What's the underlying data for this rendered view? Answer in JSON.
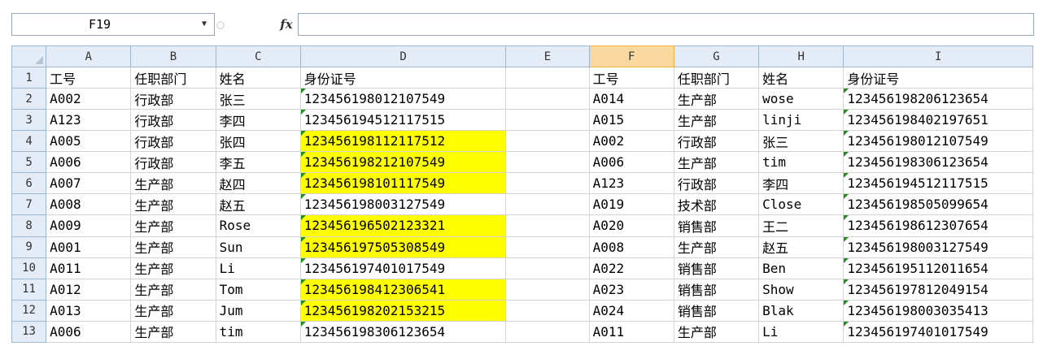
{
  "formula_bar": {
    "name_box": "F19",
    "fx_label": "fx",
    "formula": ""
  },
  "columns": [
    "A",
    "B",
    "C",
    "D",
    "E",
    "F",
    "G",
    "H",
    "I"
  ],
  "selected_column": "F",
  "highlight_color": "#ffff00",
  "rows": [
    {
      "num": "1",
      "cells": [
        "工号",
        "任职部门",
        "姓名",
        "身份证号",
        "",
        "工号",
        "任职部门",
        "姓名",
        "身份证号"
      ],
      "hl_d": false
    },
    {
      "num": "2",
      "cells": [
        "A002",
        "行政部",
        "张三",
        "123456198012107549",
        "",
        "A014",
        "生产部",
        "wose",
        "123456198206123654"
      ],
      "hl_d": false
    },
    {
      "num": "3",
      "cells": [
        "A123",
        "行政部",
        "李四",
        "123456194512117515",
        "",
        "A015",
        "生产部",
        "linji",
        "123456198402197651"
      ],
      "hl_d": false
    },
    {
      "num": "4",
      "cells": [
        "A005",
        "行政部",
        "张四",
        "123456198112117512",
        "",
        "A002",
        "行政部",
        "张三",
        "123456198012107549"
      ],
      "hl_d": true
    },
    {
      "num": "5",
      "cells": [
        "A006",
        "行政部",
        "李五",
        "123456198212107549",
        "",
        "A006",
        "生产部",
        "tim",
        "123456198306123654"
      ],
      "hl_d": true
    },
    {
      "num": "6",
      "cells": [
        "A007",
        "生产部",
        "赵四",
        "123456198101117549",
        "",
        "A123",
        "行政部",
        "李四",
        "123456194512117515"
      ],
      "hl_d": true
    },
    {
      "num": "7",
      "cells": [
        "A008",
        "生产部",
        "赵五",
        "123456198003127549",
        "",
        "A019",
        "技术部",
        "Close",
        "123456198505099654"
      ],
      "hl_d": false
    },
    {
      "num": "8",
      "cells": [
        "A009",
        "生产部",
        "Rose",
        "123456196502123321",
        "",
        "A020",
        "销售部",
        "王二",
        "123456198612307654"
      ],
      "hl_d": true
    },
    {
      "num": "9",
      "cells": [
        "A001",
        "生产部",
        "Sun",
        "123456197505308549",
        "",
        "A008",
        "生产部",
        "赵五",
        "123456198003127549"
      ],
      "hl_d": true
    },
    {
      "num": "10",
      "cells": [
        "A011",
        "生产部",
        "Li",
        "123456197401017549",
        "",
        "A022",
        "销售部",
        "Ben",
        "123456195112011654"
      ],
      "hl_d": false
    },
    {
      "num": "11",
      "cells": [
        "A012",
        "生产部",
        "Tom",
        "123456198412306541",
        "",
        "A023",
        "销售部",
        "Show",
        "123456197812049154"
      ],
      "hl_d": true
    },
    {
      "num": "12",
      "cells": [
        "A013",
        "生产部",
        "Jum",
        "123456198202153215",
        "",
        "A024",
        "销售部",
        "Blak",
        "123456198003035413"
      ],
      "hl_d": true
    },
    {
      "num": "13",
      "cells": [
        "A006",
        "生产部",
        "tim",
        "123456198306123654",
        "",
        "A011",
        "生产部",
        "Li",
        "123456197401017549"
      ],
      "hl_d": false
    }
  ]
}
